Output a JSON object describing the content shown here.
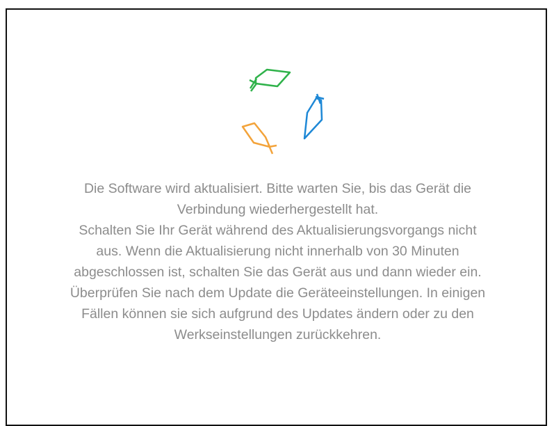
{
  "update_dialog": {
    "spinner": {
      "icon": "fish-loading-icon",
      "colors": {
        "green": "#2fb24a",
        "blue": "#1e88d6",
        "orange": "#f3a33a"
      }
    },
    "message": {
      "lines": [
        "Die Software wird aktualisiert. Bitte warten Sie, bis das Gerät die",
        "Verbindung wiederhergestellt hat.",
        "Schalten Sie Ihr Gerät während des Aktualisierungsvorgangs nicht",
        "aus. Wenn die Aktualisierung nicht innerhalb von 30 Minuten",
        "abgeschlossen ist, schalten Sie das Gerät aus und dann wieder ein.",
        "Überprüfen Sie nach dem Update die Geräteeinstellungen. In einigen",
        "Fällen können sie sich aufgrund des Updates ändern oder zu den",
        "Werkseinstellungen zurückkehren."
      ]
    },
    "text_color": "#8c8c8c"
  }
}
